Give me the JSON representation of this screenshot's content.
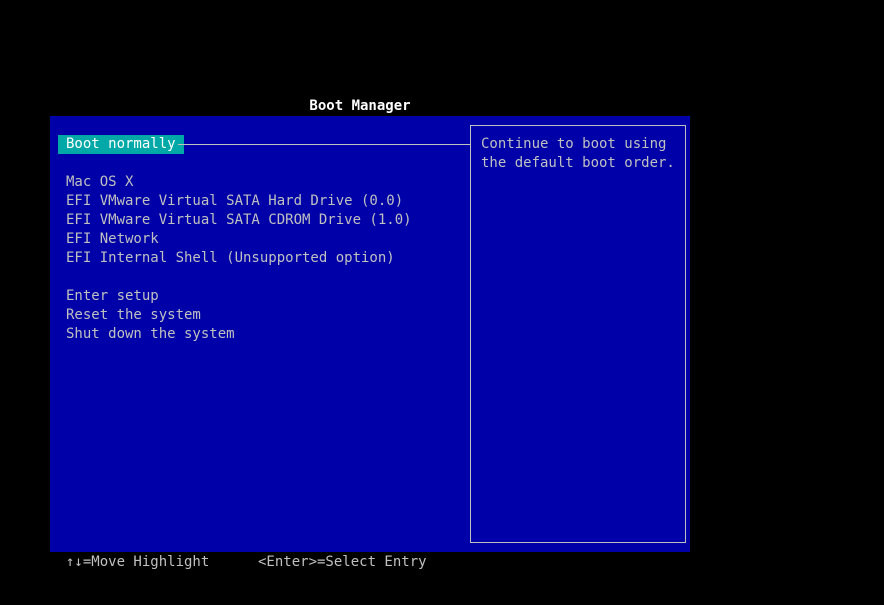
{
  "title": "Boot Manager",
  "menu": {
    "selected": "Boot normally",
    "boot_entries": [
      "Mac OS X",
      "EFI VMware Virtual SATA Hard Drive (0.0)",
      "EFI VMware Virtual SATA CDROM Drive (1.0)",
      "EFI Network",
      "EFI Internal Shell (Unsupported option)"
    ],
    "system_entries": [
      "Enter setup",
      "Reset the system",
      "Shut down the system"
    ]
  },
  "help": {
    "text": "Continue to boot using the default boot order."
  },
  "footer": {
    "move_hint": "↑↓=Move Highlight",
    "select_hint": "<Enter>=Select Entry"
  },
  "colors": {
    "background": "#000000",
    "panel": "#0000a8",
    "highlight": "#00a8a8",
    "text": "#c0c0c0",
    "title": "#ffffff"
  }
}
